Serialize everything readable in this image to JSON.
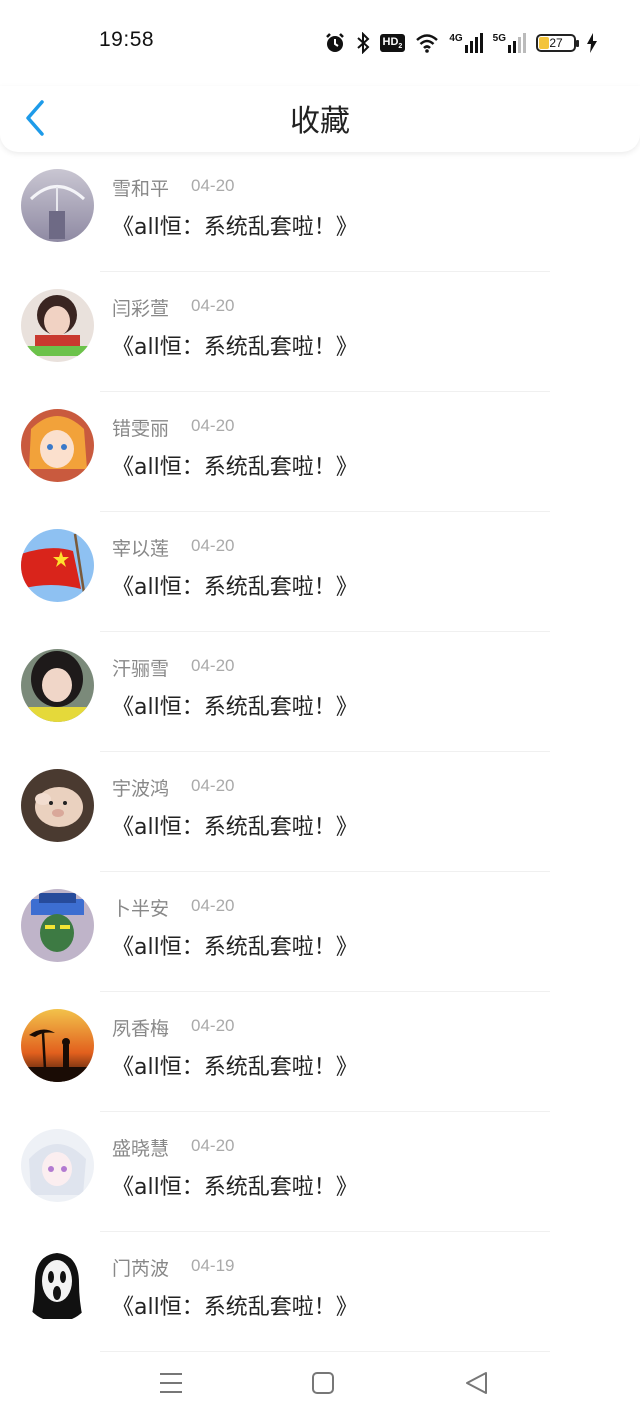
{
  "status_bar": {
    "time": "19:58",
    "hd_label": "HD",
    "net1_label": "4G",
    "net2_label": "5G",
    "battery": "27"
  },
  "header": {
    "title": "收藏"
  },
  "favorites": [
    {
      "name": "雪和平",
      "date": "04-20",
      "title": "《all恒：系统乱套啦！》"
    },
    {
      "name": "闫彩萱",
      "date": "04-20",
      "title": "《all恒：系统乱套啦！》"
    },
    {
      "name": "错雯丽",
      "date": "04-20",
      "title": "《all恒：系统乱套啦！》"
    },
    {
      "name": "宰以莲",
      "date": "04-20",
      "title": "《all恒：系统乱套啦！》"
    },
    {
      "name": "汗骊雪",
      "date": "04-20",
      "title": "《all恒：系统乱套啦！》"
    },
    {
      "name": "宇波鸿",
      "date": "04-20",
      "title": "《all恒：系统乱套啦！》"
    },
    {
      "name": "卜半安",
      "date": "04-20",
      "title": "《all恒：系统乱套啦！》"
    },
    {
      "name": "夙香梅",
      "date": "04-20",
      "title": "《all恒：系统乱套啦！》"
    },
    {
      "name": "盛晓慧",
      "date": "04-20",
      "title": "《all恒：系统乱套啦！》"
    },
    {
      "name": "门芮波",
      "date": "04-19",
      "title": "《all恒：系统乱套啦！》"
    }
  ],
  "colors": {
    "accent": "#1e9be9",
    "background": "#ffffff"
  },
  "icons": {
    "back": "chevron-left-icon",
    "alarm": "alarm-icon",
    "bluetooth": "bluetooth-icon",
    "wifi": "wifi-icon",
    "nav_menu": "menu-icon",
    "nav_home": "home-square-icon",
    "nav_back": "back-triangle-icon"
  }
}
